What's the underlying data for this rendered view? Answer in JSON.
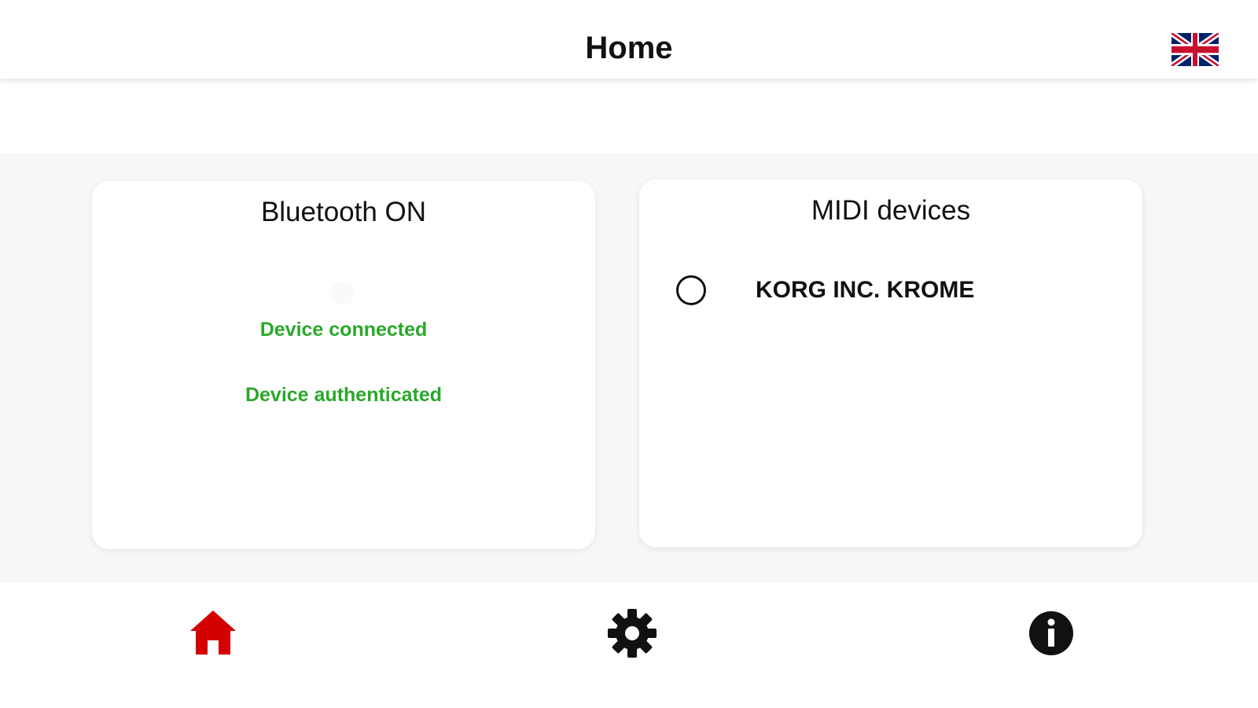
{
  "header": {
    "title": "Home",
    "language_icon": "uk-flag-icon"
  },
  "bluetooth_card": {
    "title": "Bluetooth ON",
    "status_connected": "Device connected",
    "status_authenticated": "Device authenticated",
    "status_color": "#2aa82a"
  },
  "midi_card": {
    "title": "MIDI devices",
    "devices": [
      {
        "name": "KORG INC. KROME",
        "selected": false
      }
    ]
  },
  "bottom_nav": {
    "items": [
      {
        "icon": "home-icon",
        "active": true,
        "color": "#d40000"
      },
      {
        "icon": "gear-icon",
        "active": false,
        "color": "#111111"
      },
      {
        "icon": "info-icon",
        "active": false,
        "color": "#111111"
      }
    ]
  }
}
